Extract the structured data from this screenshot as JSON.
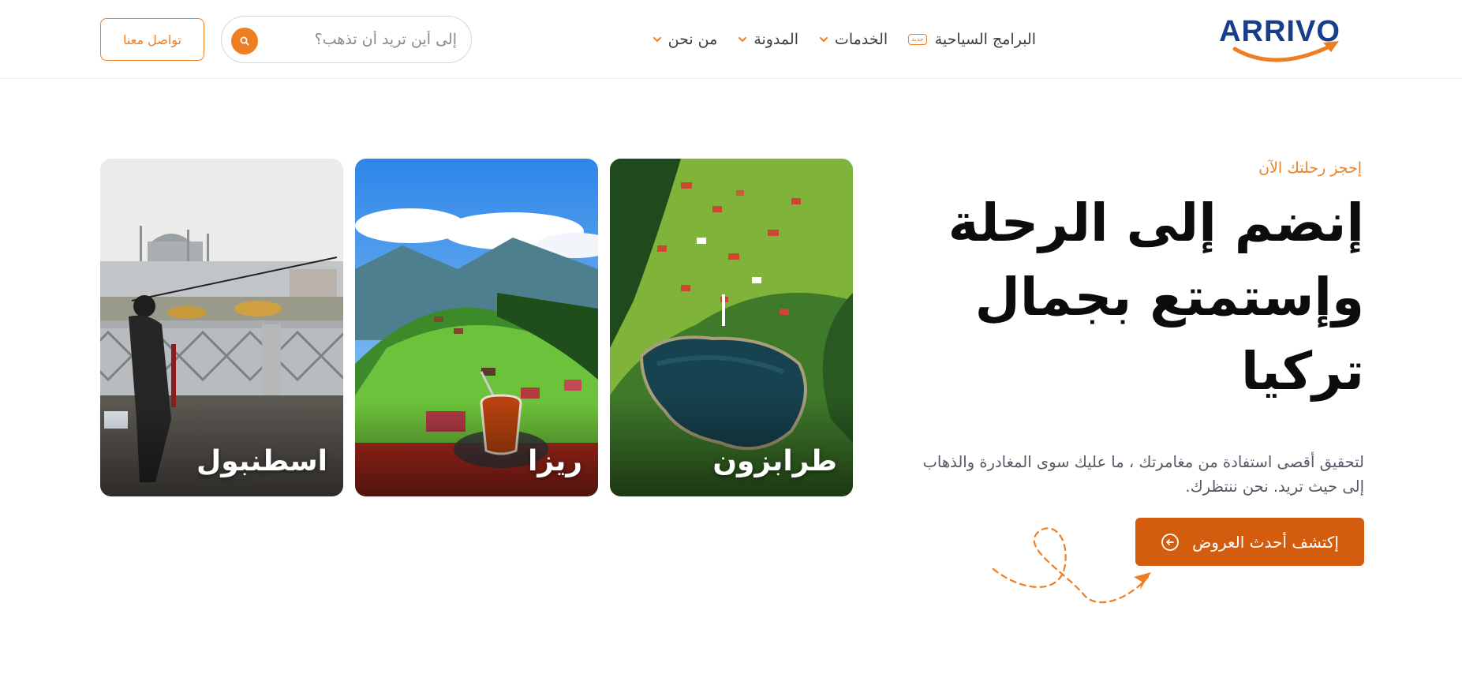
{
  "header": {
    "logo_text": "ARRIVO",
    "nav": [
      {
        "label": "البرامج السياحية",
        "badge": "جديد"
      },
      {
        "label": "الخدمات"
      },
      {
        "label": "المدونة"
      },
      {
        "label": "من نحن"
      }
    ],
    "search": {
      "placeholder": "إلى أين تريد أن تذهب؟"
    },
    "contact_label": "تواصل معنا"
  },
  "hero": {
    "eyebrow": "إحجز رحلتك الآن",
    "title_lines": [
      "إنضم إلى الرحلة",
      "وإستمتع بجمال",
      "تركيا"
    ],
    "subtitle_lines": [
      "لتحقيق أقصى استفادة من مغامرتك ، ما عليك سوى المغادرة والذهاب",
      "إلى حيث تريد. نحن ننتظرك."
    ],
    "cta_label": "إكتشف أحدث العروض"
  },
  "cards": [
    {
      "label": "طرابزون"
    },
    {
      "label": "ريزا"
    },
    {
      "label": "اسطنبول"
    }
  ],
  "colors": {
    "brand_orange": "#ef7d22",
    "cta_orange": "#d35c0e",
    "logo_blue": "#173e8a"
  },
  "icons": [
    "chevron-down-icon",
    "search-icon",
    "arrow-left-circle-icon",
    "paper-plane-icon"
  ]
}
